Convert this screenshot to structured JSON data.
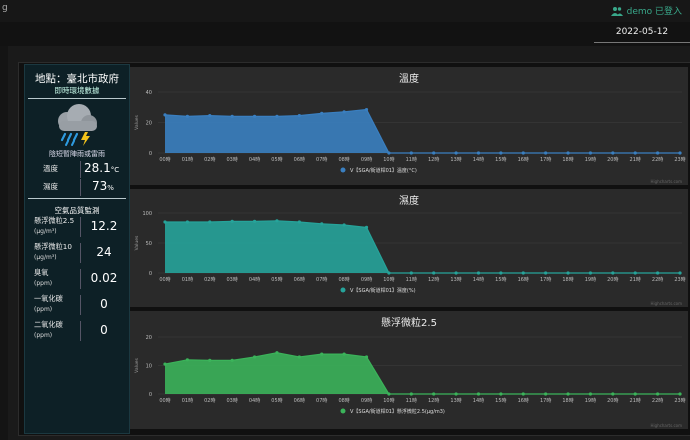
{
  "topbar": {
    "title_fragment": "g",
    "user_label": "demo 已登入"
  },
  "date": "2022-05-12",
  "sidebar": {
    "location": "地點：臺北市政府",
    "subtitle": "即時環境數據",
    "weather_icon": "thunderstorm-icon",
    "weather_text": "陰短暫陣雨或雷雨",
    "temperature": {
      "label": "溫度",
      "value": "28.1",
      "unit": "°C"
    },
    "humidity": {
      "label": "濕度",
      "value": "73",
      "unit": "%"
    },
    "air_quality_title": "空氣品質監測",
    "air_quality": [
      {
        "label": "懸浮微粒2.5",
        "unit": "(μg/m³)",
        "value": "12.2"
      },
      {
        "label": "懸浮微粒10",
        "unit": "(μg/m³)",
        "value": "24"
      },
      {
        "label": "臭氧",
        "unit": "(ppm)",
        "value": "0.02"
      },
      {
        "label": "一氧化碳",
        "unit": "(ppm)",
        "value": "0"
      },
      {
        "label": "二氧化碳",
        "unit": "(ppm)",
        "value": "0"
      }
    ]
  },
  "chart_data": [
    {
      "type": "area",
      "title": "溫度",
      "ylabel": "Values",
      "ylim": [
        0,
        40
      ],
      "yticks": [
        0,
        20,
        40
      ],
      "categories": [
        "00時",
        "01時",
        "02時",
        "03時",
        "04時",
        "05時",
        "06時",
        "07時",
        "08時",
        "09時",
        "10時",
        "11時",
        "12時",
        "13時",
        "14時",
        "15時",
        "16時",
        "17時",
        "18時",
        "19時",
        "20時",
        "21時",
        "22時",
        "23時"
      ],
      "series": [
        {
          "name": "V【SGA/街道桿01】溫度(°C)",
          "color": "#3a7fc0",
          "values": [
            25,
            24,
            24.5,
            24,
            24,
            24,
            24.5,
            26,
            27,
            28.5,
            0,
            0,
            0,
            0,
            0,
            0,
            0,
            0,
            0,
            0,
            0,
            0,
            0,
            0
          ]
        }
      ],
      "credit": "Highcharts.com"
    },
    {
      "type": "area",
      "title": "濕度",
      "ylabel": "Values",
      "ylim": [
        0,
        100
      ],
      "yticks": [
        0,
        50,
        100
      ],
      "categories": [
        "00時",
        "01時",
        "02時",
        "03時",
        "04時",
        "05時",
        "06時",
        "07時",
        "08時",
        "09時",
        "10時",
        "11時",
        "12時",
        "13時",
        "14時",
        "15時",
        "16時",
        "17時",
        "18時",
        "19時",
        "20時",
        "21時",
        "22時",
        "23時"
      ],
      "series": [
        {
          "name": "V【SGA/街道桿01】濕度(%)",
          "color": "#26a39a",
          "values": [
            85,
            85,
            85,
            86,
            86,
            87,
            85,
            82,
            80,
            76,
            0,
            0,
            0,
            0,
            0,
            0,
            0,
            0,
            0,
            0,
            0,
            0,
            0,
            0
          ]
        }
      ],
      "credit": "Highcharts.com"
    },
    {
      "type": "area",
      "title": "懸浮微粒2.5",
      "ylabel": "Values",
      "ylim": [
        0,
        20
      ],
      "yticks": [
        0,
        10,
        20
      ],
      "categories": [
        "00時",
        "01時",
        "02時",
        "03時",
        "04時",
        "05時",
        "06時",
        "07時",
        "08時",
        "09時",
        "10時",
        "11時",
        "12時",
        "13時",
        "14時",
        "15時",
        "16時",
        "17時",
        "18時",
        "19時",
        "20時",
        "21時",
        "22時",
        "23時"
      ],
      "series": [
        {
          "name": "V【SGA/街道桿01】懸浮微粒2.5(μg/m3)",
          "color": "#3bb35a",
          "values": [
            10.5,
            12,
            11.8,
            11.8,
            13,
            14.5,
            13,
            14,
            14,
            13,
            0,
            0,
            0,
            0,
            0,
            0,
            0,
            0,
            0,
            0,
            0,
            0,
            0,
            0
          ]
        }
      ],
      "credit": "Highcharts.com"
    }
  ]
}
